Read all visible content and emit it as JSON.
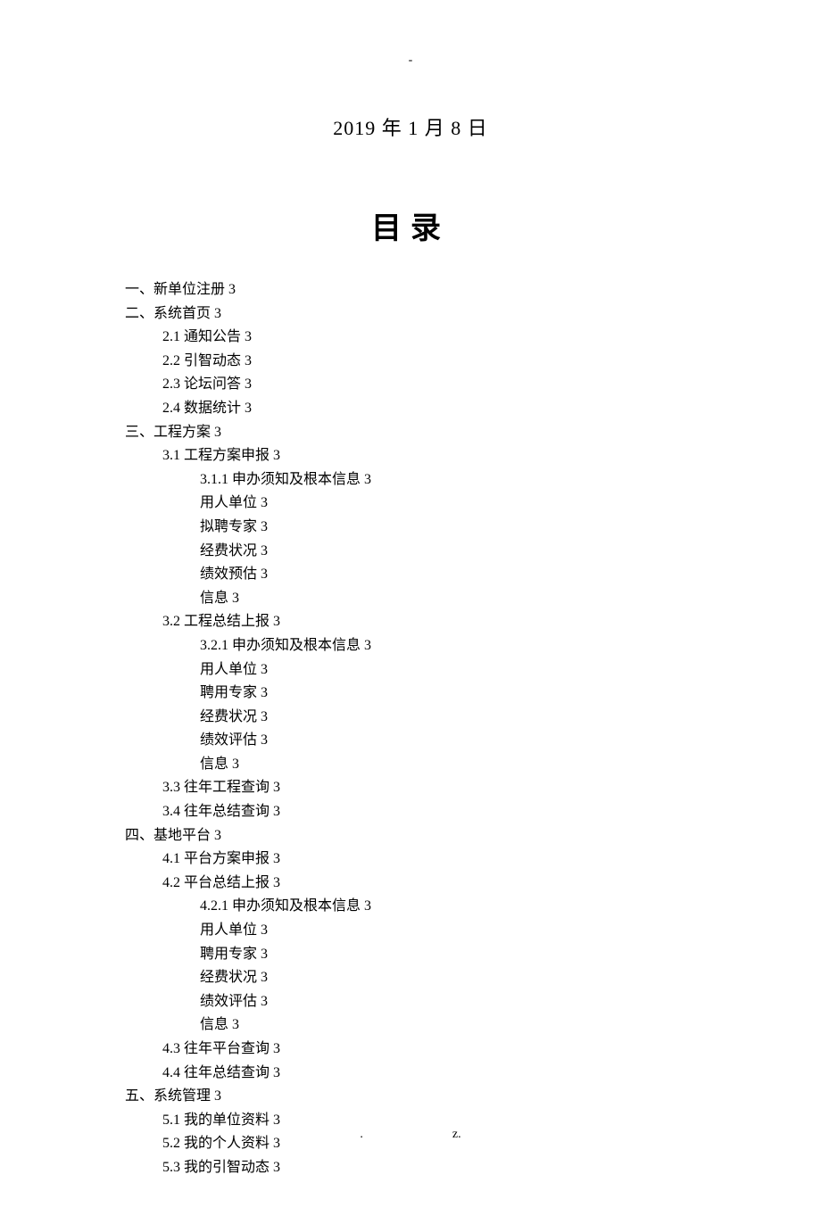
{
  "header_mark": "-",
  "date": "2019 年 1 月 8 日",
  "toc_title": "目录",
  "entries": [
    {
      "level": 0,
      "text": "一、新单位注册 3"
    },
    {
      "level": 0,
      "text": "二、系统首页 3"
    },
    {
      "level": 1,
      "text": "2.1 通知公告 3"
    },
    {
      "level": 1,
      "text": "2.2 引智动态 3"
    },
    {
      "level": 1,
      "text": "2.3 论坛问答 3"
    },
    {
      "level": 1,
      "text": "2.4 数据统计 3"
    },
    {
      "level": 0,
      "text": "三、工程方案 3"
    },
    {
      "level": 1,
      "text": "3.1 工程方案申报 3"
    },
    {
      "level": 2,
      "text": "3.1.1 申办须知及根本信息 3"
    },
    {
      "level": 2,
      "text": "用人单位 3"
    },
    {
      "level": 2,
      "text": "拟聘专家 3"
    },
    {
      "level": 2,
      "text": "经费状况 3"
    },
    {
      "level": 2,
      "text": "绩效预估 3"
    },
    {
      "level": 2,
      "text": "信息 3"
    },
    {
      "level": 1,
      "text": "3.2 工程总结上报 3"
    },
    {
      "level": 2,
      "text": "3.2.1 申办须知及根本信息 3"
    },
    {
      "level": 2,
      "text": "用人单位 3"
    },
    {
      "level": 2,
      "text": "聘用专家 3"
    },
    {
      "level": 2,
      "text": "经费状况 3"
    },
    {
      "level": 2,
      "text": "绩效评估 3"
    },
    {
      "level": 2,
      "text": "信息 3"
    },
    {
      "level": 1,
      "text": "3.3 往年工程查询 3"
    },
    {
      "level": 1,
      "text": "3.4 往年总结查询 3"
    },
    {
      "level": 0,
      "text": "四、基地平台 3"
    },
    {
      "level": 1,
      "text": "4.1 平台方案申报 3"
    },
    {
      "level": 1,
      "text": "4.2 平台总结上报 3"
    },
    {
      "level": 2,
      "text": "4.2.1 申办须知及根本信息 3"
    },
    {
      "level": 2,
      "text": "用人单位 3"
    },
    {
      "level": 2,
      "text": "聘用专家 3"
    },
    {
      "level": 2,
      "text": "经费状况 3"
    },
    {
      "level": 2,
      "text": "绩效评估 3"
    },
    {
      "level": 2,
      "text": "信息 3"
    },
    {
      "level": 1,
      "text": "4.3 往年平台查询 3"
    },
    {
      "level": 1,
      "text": "4.4 往年总结查询 3"
    },
    {
      "level": 0,
      "text": "五、系统管理 3"
    },
    {
      "level": 1,
      "text": "5.1 我的单位资料 3"
    },
    {
      "level": 1,
      "text": "5.2 我的个人资料 3"
    },
    {
      "level": 1,
      "text": "5.3 我的引智动态 3"
    }
  ],
  "footer_dot": ".",
  "footer_z": "z."
}
